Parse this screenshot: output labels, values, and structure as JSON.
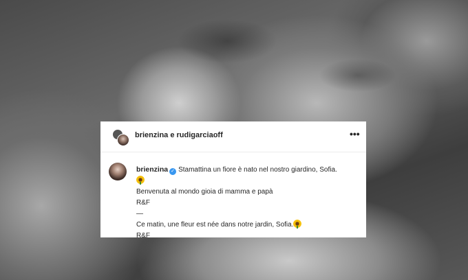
{
  "header": {
    "title": "brienzina e rudigarciaoff",
    "more_icon": "more-horizontal-icon"
  },
  "post": {
    "username": "brienzina",
    "verified_icon": "verified-badge-icon",
    "line1": "Stamattina un fiore è nato nel nostro giardino, Sofia.",
    "line2_icon": "sunflower-emoji",
    "line3": "Benvenuta al mondo gioia di mamma e papà",
    "line4": "R&F",
    "line5": "—",
    "line6": "Ce matin, une fleur est née dans notre jardin, Sofia.",
    "line7": "R&F"
  },
  "colors": {
    "verified": "#3897f0",
    "text": "#262626"
  }
}
